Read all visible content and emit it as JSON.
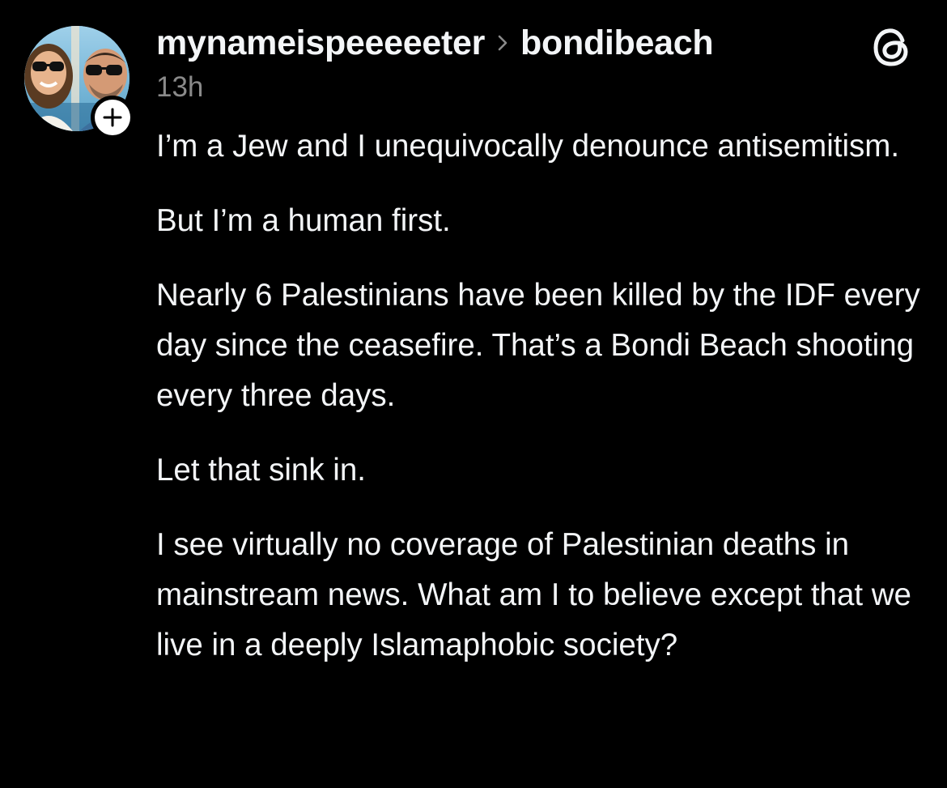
{
  "post": {
    "author": {
      "username": "mynameispeeeeeter",
      "avatar_icon": "avatar-photo-couple"
    },
    "community": "bondibeach",
    "separator_icon": "chevron-right-icon",
    "timestamp": "13h",
    "follow_icon": "plus-icon",
    "app_icon": "threads-logo-icon",
    "paragraphs": [
      "I’m a Jew and I unequivocally denounce antisemitism.",
      "But I’m a human first.",
      "Nearly 6 Palestinians have been killed by the IDF every day since the ceasefire. That’s a Bondi Beach shooting every three days.",
      "Let that sink in.",
      "I see virtually no coverage of Palestinian deaths in mainstream news. What am I to believe except that we live in a deeply Islamaphobic society?"
    ]
  },
  "colors": {
    "background": "#000000",
    "primary_text": "#f3f5f7",
    "secondary_text": "#8a8a8a",
    "badge_background": "#ffffff"
  }
}
